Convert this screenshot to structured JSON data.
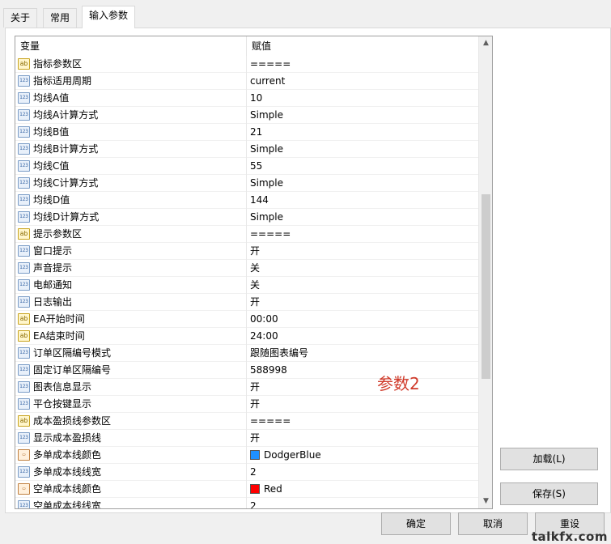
{
  "tabs": [
    {
      "label": "关于"
    },
    {
      "label": "常用"
    },
    {
      "label": "输入参数"
    }
  ],
  "grid": {
    "header_variable": "变量",
    "header_value": "赋值",
    "rows": [
      {
        "icon": "ab",
        "variable": "指标参数区",
        "value": "====="
      },
      {
        "icon": "123",
        "variable": "指标适用周期",
        "value": "current"
      },
      {
        "icon": "123",
        "variable": "均线A值",
        "value": "10"
      },
      {
        "icon": "123",
        "variable": "均线A计算方式",
        "value": "Simple"
      },
      {
        "icon": "123",
        "variable": "均线B值",
        "value": "21"
      },
      {
        "icon": "123",
        "variable": "均线B计算方式",
        "value": "Simple"
      },
      {
        "icon": "123",
        "variable": "均线C值",
        "value": "55"
      },
      {
        "icon": "123",
        "variable": "均线C计算方式",
        "value": "Simple"
      },
      {
        "icon": "123",
        "variable": "均线D值",
        "value": "144"
      },
      {
        "icon": "123",
        "variable": "均线D计算方式",
        "value": "Simple"
      },
      {
        "icon": "ab",
        "variable": "提示参数区",
        "value": "====="
      },
      {
        "icon": "123",
        "variable": "窗口提示",
        "value": "开"
      },
      {
        "icon": "123",
        "variable": "声音提示",
        "value": "关"
      },
      {
        "icon": "123",
        "variable": "电邮通知",
        "value": "关"
      },
      {
        "icon": "123",
        "variable": "日志输出",
        "value": "开"
      },
      {
        "icon": "ab",
        "variable": "EA开始时间",
        "value": "00:00"
      },
      {
        "icon": "ab",
        "variable": "EA结束时间",
        "value": "24:00"
      },
      {
        "icon": "123",
        "variable": "订单区隔编号模式",
        "value": "跟随图表编号"
      },
      {
        "icon": "123",
        "variable": "固定订单区隔编号",
        "value": "588998"
      },
      {
        "icon": "123",
        "variable": "图表信息显示",
        "value": "开"
      },
      {
        "icon": "123",
        "variable": "平仓按键显示",
        "value": "开"
      },
      {
        "icon": "ab",
        "variable": "成本盈损线参数区",
        "value": "====="
      },
      {
        "icon": "123",
        "variable": "显示成本盈损线",
        "value": "开"
      },
      {
        "icon": "color",
        "variable": "多单成本线颜色",
        "value": "DodgerBlue",
        "swatch": "#1e90ff"
      },
      {
        "icon": "123",
        "variable": "多单成本线线宽",
        "value": "2"
      },
      {
        "icon": "color",
        "variable": "空单成本线颜色",
        "value": "Red",
        "swatch": "#ff0000"
      },
      {
        "icon": "123",
        "variable": "空单成本线线宽",
        "value": "2"
      }
    ]
  },
  "annotation": "参数2",
  "buttons": {
    "load": "加载(L)",
    "save": "保存(S)",
    "ok": "确定",
    "cancel": "取消",
    "reset": "重设"
  },
  "watermark": "talkfx.com",
  "icons": {
    "scroll_up": "chevron-up-icon",
    "scroll_down": "chevron-down-icon"
  }
}
